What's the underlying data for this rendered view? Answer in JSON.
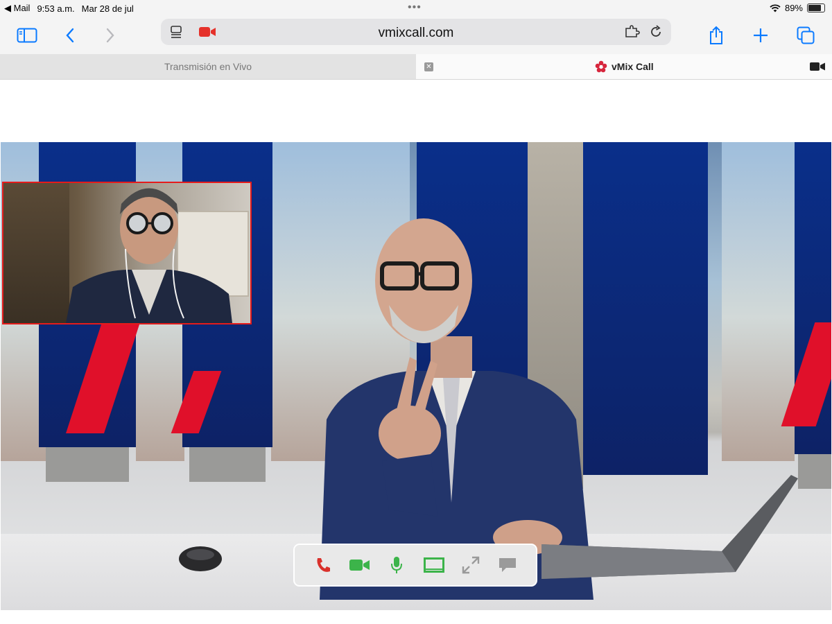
{
  "status_bar": {
    "back_app": "◀ Mail",
    "time": "9:53 a.m.",
    "date": "Mar 28 de jul",
    "battery": "89%",
    "battery_level": 0.89
  },
  "toolbar": {
    "url": "vmixcall.com"
  },
  "tabs": [
    {
      "label": "Transmisión en Vivo",
      "active": false
    },
    {
      "label": "vMix Call",
      "active": true
    }
  ],
  "colors": {
    "accent_blue": "#0a7aff",
    "record_red": "#e5312a",
    "call_red": "#d9312b",
    "call_green": "#3cb44a",
    "pip_border": "#e51b1b"
  },
  "controls": [
    {
      "icon": "hangup-icon"
    },
    {
      "icon": "camera-icon"
    },
    {
      "icon": "microphone-icon"
    },
    {
      "icon": "screen-icon"
    },
    {
      "icon": "fullscreen-icon"
    },
    {
      "icon": "chat-icon"
    }
  ]
}
